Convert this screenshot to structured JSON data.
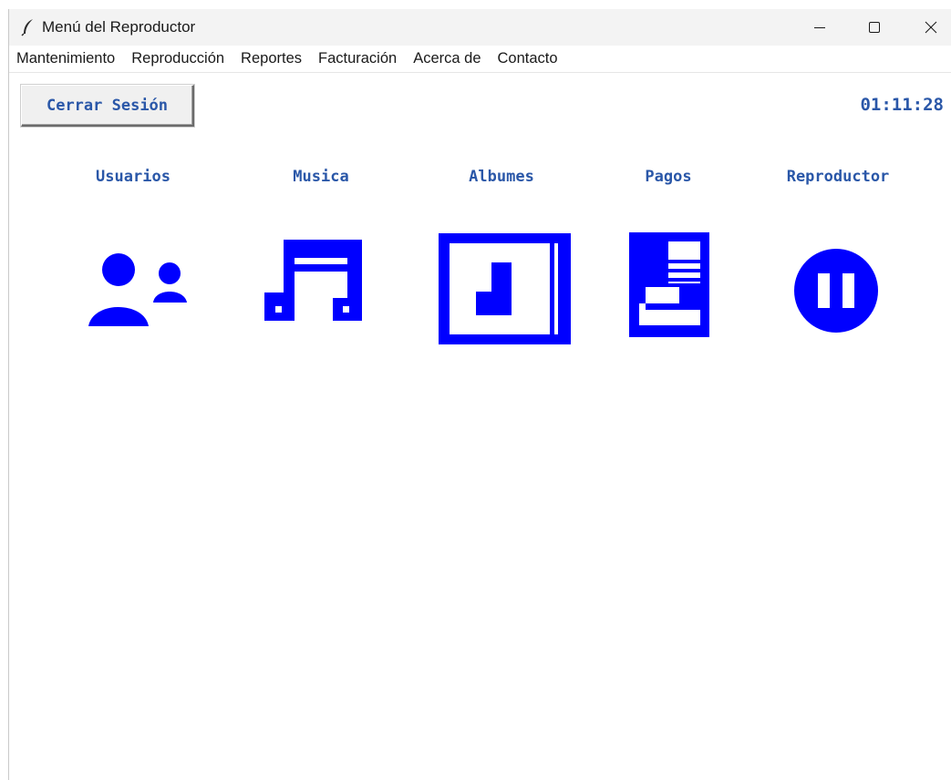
{
  "window": {
    "title": "Menú del Reproductor"
  },
  "menubar": {
    "items": [
      "Mantenimiento",
      "Reproducción",
      "Reportes",
      "Facturación",
      "Acerca de",
      "Contacto"
    ]
  },
  "toolbar": {
    "logout_label": "Cerrar Sesión",
    "clock": "01:11:28"
  },
  "nav": {
    "items": [
      {
        "label": "Usuarios",
        "icon": "users-icon"
      },
      {
        "label": "Musica",
        "icon": "music-note-icon"
      },
      {
        "label": "Albumes",
        "icon": "album-icon"
      },
      {
        "label": "Pagos",
        "icon": "payment-icon"
      },
      {
        "label": "Reproductor",
        "icon": "pause-circle-icon"
      }
    ]
  },
  "colors": {
    "icon_blue": "#0000ff",
    "label_blue": "#2a57a8"
  }
}
